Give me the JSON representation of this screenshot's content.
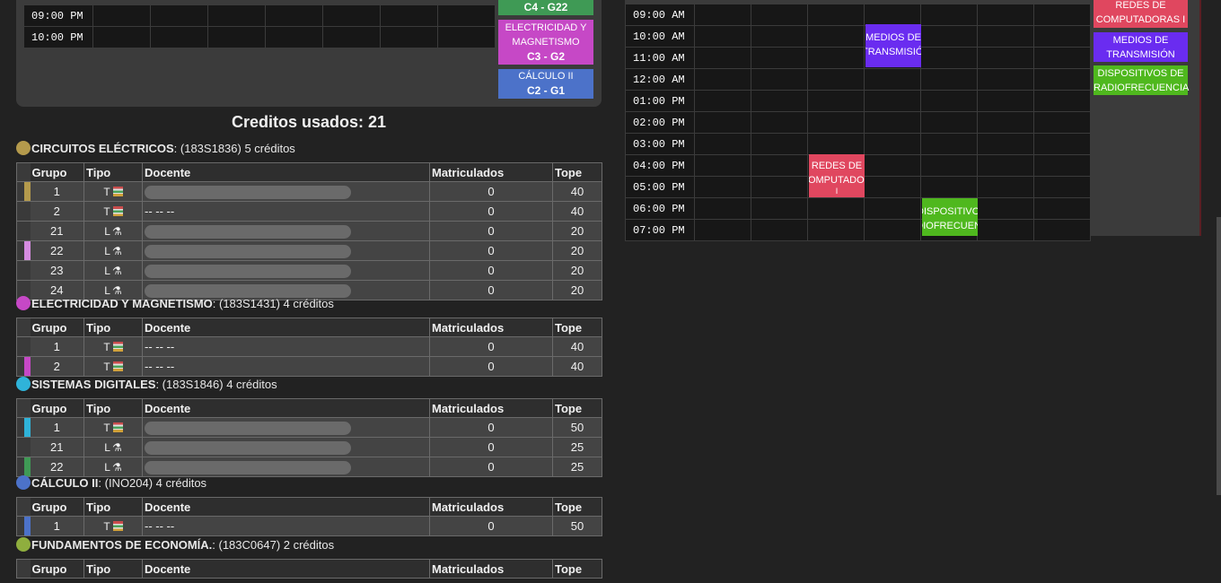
{
  "left_schedule": {
    "rows": [
      {
        "time": "09:00 PM"
      },
      {
        "time": "10:00 PM"
      }
    ],
    "side_courses": [
      {
        "name": "",
        "code": "C4 - G22",
        "color": "#3f9a55"
      },
      {
        "name": "ELECTRICIDAD Y MAGNETISMO",
        "code": "C3 - G2",
        "color": "#c648c6"
      },
      {
        "name": "CÁLCULO II",
        "code": "C2 - G1",
        "color": "#4c72c9"
      }
    ]
  },
  "credits_label": "Creditos usados: 21",
  "table_headers": {
    "grupo": "Grupo",
    "tipo": "Tipo",
    "docente": "Docente",
    "matriculados": "Matriculados",
    "tope": "Tope"
  },
  "courses": [
    {
      "name": "CIRCUITOS ELÉCTRICOS",
      "meta": ": (183S1836) 5 créditos",
      "color": "#b49a4c",
      "groups": [
        {
          "grupo": "1",
          "tipo": "T",
          "docente": "",
          "matriculados": "0",
          "tope": "40",
          "mark": "#b49a4c"
        },
        {
          "grupo": "2",
          "tipo": "T",
          "docente": "-- -- --",
          "matriculados": "0",
          "tope": "40",
          "mark": ""
        },
        {
          "grupo": "21",
          "tipo": "L",
          "docente": "",
          "matriculados": "0",
          "tope": "20",
          "mark": ""
        },
        {
          "grupo": "22",
          "tipo": "L",
          "docente": "",
          "matriculados": "0",
          "tope": "20",
          "mark": "#d58be0"
        },
        {
          "grupo": "23",
          "tipo": "L",
          "docente": "",
          "matriculados": "0",
          "tope": "20",
          "mark": ""
        },
        {
          "grupo": "24",
          "tipo": "L",
          "docente": "",
          "matriculados": "0",
          "tope": "20",
          "mark": ""
        }
      ]
    },
    {
      "name": "ELECTRICIDAD Y MAGNETISMO",
      "meta": ": (183S1431) 4 créditos",
      "color": "#c648c6",
      "groups": [
        {
          "grupo": "1",
          "tipo": "T",
          "docente": "-- -- --",
          "matriculados": "0",
          "tope": "40",
          "mark": ""
        },
        {
          "grupo": "2",
          "tipo": "T",
          "docente": "-- -- --",
          "matriculados": "0",
          "tope": "40",
          "mark": "#c648c6"
        }
      ]
    },
    {
      "name": "SISTEMAS DIGITALES",
      "meta": ": (183S1846) 4 créditos",
      "color": "#2fb3d9",
      "groups": [
        {
          "grupo": "1",
          "tipo": "T",
          "docente": "",
          "matriculados": "0",
          "tope": "50",
          "mark": "#2fb3d9"
        },
        {
          "grupo": "21",
          "tipo": "L",
          "docente": "",
          "matriculados": "0",
          "tope": "25",
          "mark": ""
        },
        {
          "grupo": "22",
          "tipo": "L",
          "docente": "",
          "matriculados": "0",
          "tope": "25",
          "mark": "#3f9a55"
        }
      ]
    },
    {
      "name": "CÁLCULO II",
      "meta": ": (INO204) 4 créditos",
      "color": "#4c72c9",
      "groups": [
        {
          "grupo": "1",
          "tipo": "T",
          "docente": "-- -- --",
          "matriculados": "0",
          "tope": "50",
          "mark": "#4c72c9"
        }
      ]
    },
    {
      "name": "FUNDAMENTOS DE ECONOMÍA.",
      "meta": ": (183C0647) 2 créditos",
      "color": "#8fae3e",
      "groups": []
    }
  ],
  "right_schedule": {
    "times": [
      "09:00 AM",
      "10:00 AM",
      "11:00 AM",
      "12:00 AM",
      "01:00 PM",
      "02:00 PM",
      "03:00 PM",
      "04:00 PM",
      "05:00 PM",
      "06:00 PM",
      "07:00 PM"
    ],
    "blocks": [
      {
        "label1": "MEDIOS DE",
        "label2": "TRANSMISIÓN",
        "color": "#6a2cf0"
      },
      {
        "label1": "REDES DE",
        "label2": "COMPUTADORAS",
        "label3": "I",
        "color": "#e0475f"
      },
      {
        "label1": "DISPOSITIVOS",
        "label2": "RADIOFRECUENCIA",
        "color": "#4fb81e"
      }
    ],
    "side_courses": [
      {
        "label1": "REDES DE",
        "label2": "COMPUTADORAS I",
        "color": "#e0475f"
      },
      {
        "label1": "MEDIOS DE",
        "label2": "TRANSMISIÓN",
        "color": "#6a2cf0"
      },
      {
        "label1": "DISPOSITIVOS DE",
        "label2": "RADIOFRECUENCIA",
        "color": "#4fb81e"
      }
    ]
  }
}
